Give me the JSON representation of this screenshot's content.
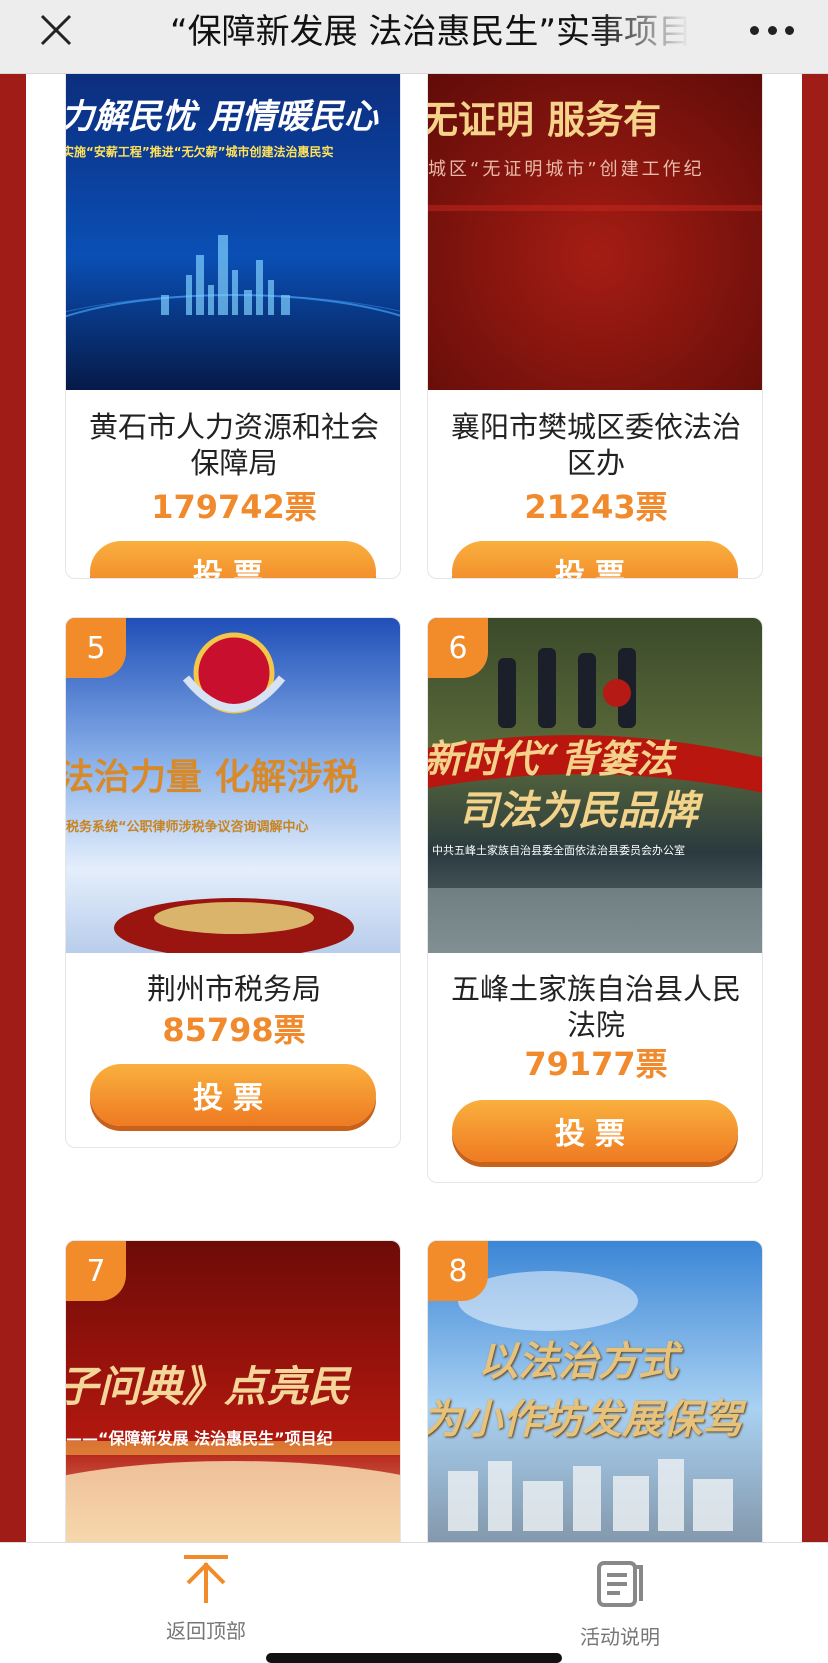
{
  "nav": {
    "title": "“保障新发展 法治惠民生”实事项目投票",
    "close_icon": "close-icon",
    "more_icon": "more-dots-icon"
  },
  "colors": {
    "accent_orange": "#f08a2c",
    "border_red": "#9f1c17",
    "button_gradient_top": "#f9b03e",
    "button_gradient_bottom": "#ef7a22"
  },
  "cards": [
    {
      "name": "黄石市人力资源和社会保障局",
      "votes": "179742票",
      "vote_label": "投票",
      "image_text": "力解民忧 用情暖民心",
      "image_subtext": "实施“安薪工程”推进“无欠薪”城市创建法治惠民实"
    },
    {
      "name": "襄阳市樊城区委依法治区办",
      "votes": "21243票",
      "vote_label": "投票",
      "image_text": "无证明 服务有",
      "image_subtext": "城区“无证明城市”创建工作纪"
    },
    {
      "rank": "5",
      "name": "荆州市税务局",
      "votes": "85798票",
      "vote_label": "投票",
      "image_text": "法治力量 化解涉税",
      "image_subtext": "税务系统“公职律师涉税争议咨询调解中心"
    },
    {
      "rank": "6",
      "name": "五峰土家族自治县人民法院",
      "votes": "79177票",
      "vote_label": "投票",
      "image_text": "新时代“背篓法",
      "image_subtext": "司法为民品牌",
      "image_caption": "中共五峰土家族自治县委全面依法治县委员会办公室"
    },
    {
      "rank": "7",
      "image_text": "子问典》点亮民",
      "image_subtext": "——“保障新发展 法治惠民生”项目纪"
    },
    {
      "rank": "8",
      "image_text": "以法治方式",
      "image_subtext": "为小作坊发展保驾"
    }
  ],
  "bottom_bar": {
    "back_top_label": "返回顶部",
    "back_top_icon": "arrow-up-icon",
    "rules_label": "活动说明",
    "rules_icon": "document-icon"
  }
}
